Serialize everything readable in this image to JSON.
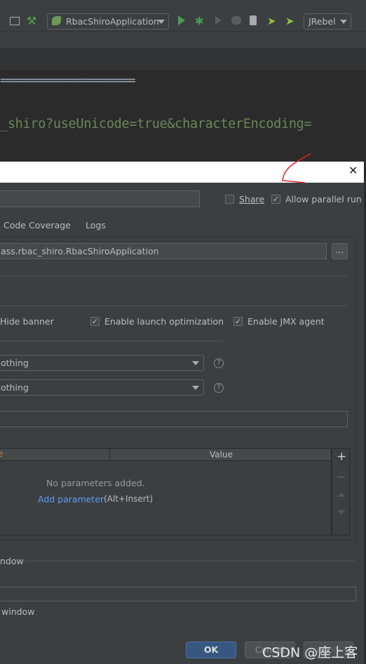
{
  "toolbar": {
    "run_config": "RbacShiroApplication",
    "jrebel": "JRebel"
  },
  "editor": {
    "line1": "======================",
    "line2": "_shiro?useUnicode=true&characterEncoding="
  },
  "dialog": {
    "share_label": "Share",
    "share_checked": false,
    "parallel_label": "Allow parallel run",
    "parallel_checked": true,
    "tabs": [
      "Code Coverage",
      "Logs"
    ],
    "main_class": "ass.rbac_shiro.RbacShiroApplication",
    "browse_label": "...",
    "hide_banner": "Hide banner",
    "launch_opt": "Enable launch optimization",
    "jmx": "Enable JMX agent",
    "update_action": "othing",
    "frame_deactivation": "othing",
    "table": {
      "col_name": "e",
      "col_value": "Value",
      "empty": "No parameters added.",
      "add_link": "Add parameter",
      "add_shortcut": "(Alt+Insert)"
    },
    "section_window": "ndow",
    "open_window": "window",
    "ok": "OK",
    "cancel": "Cancel",
    "apply": "Apply"
  },
  "watermark": "CSDN @座上客",
  "colors": {
    "accent_link": "#589df6",
    "ok_button": "#365880",
    "annotation": "#e0202a"
  }
}
